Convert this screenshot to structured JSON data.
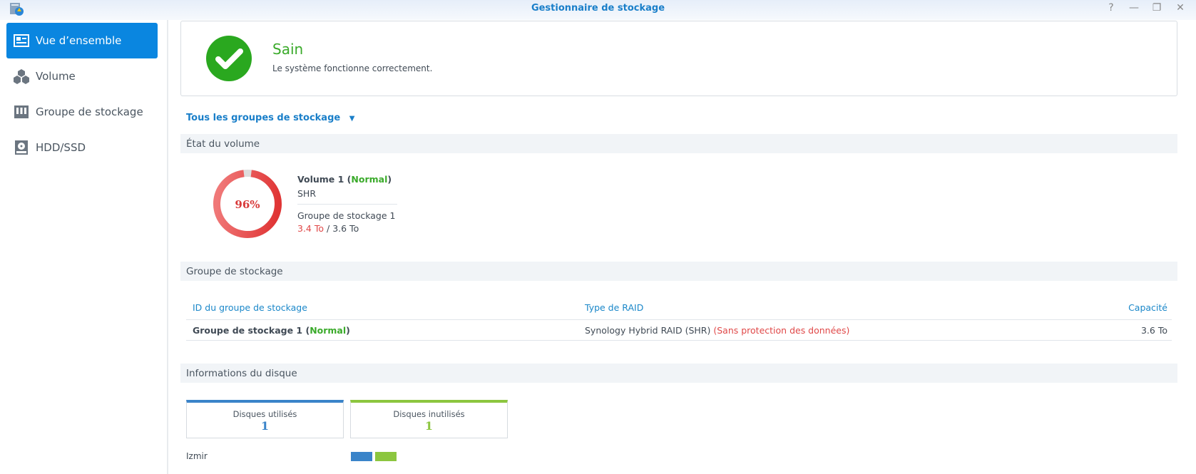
{
  "window": {
    "title": "Gestionnaire de stockage",
    "controls": [
      "?",
      "—",
      "❐",
      "✕"
    ]
  },
  "sidebar": {
    "items": [
      {
        "label": "Vue d’ensemble",
        "icon": "overview-icon"
      },
      {
        "label": "Volume",
        "icon": "volume-icon"
      },
      {
        "label": "Groupe de stockage",
        "icon": "storage-pool-icon"
      },
      {
        "label": "HDD/SSD",
        "icon": "hdd-icon"
      }
    ]
  },
  "status": {
    "title": "Sain",
    "message": "Le système fonctionne correctement.",
    "color": "#2aa81f"
  },
  "filter": {
    "label": "Tous les groupes de stockage"
  },
  "volume_section": {
    "header": "État du volume",
    "name": "Volume 1",
    "state": "Normal",
    "type": "SHR",
    "pool": "Groupe de stockage 1",
    "used": "3.4 To",
    "total": "3.6 To",
    "sep": "/",
    "percent": 96,
    "percent_label": "96%"
  },
  "pool_section": {
    "header": "Groupe de stockage",
    "columns": [
      "ID du groupe de stockage",
      "Type de RAID",
      "Capacité"
    ],
    "rows": [
      {
        "id": "Groupe de stockage 1",
        "state": "Normal",
        "raid": "Synology Hybrid RAID (SHR)",
        "warning": "(Sans protection des données)",
        "capacity": "3.6 To"
      }
    ]
  },
  "disk_section": {
    "header": "Informations du disque",
    "used_label": "Disques utilisés",
    "used_count": "1",
    "unused_label": "Disques inutilisés",
    "unused_count": "1",
    "host": "Izmir",
    "used_color": "#3a84c9",
    "unused_color": "#8cc63f"
  }
}
